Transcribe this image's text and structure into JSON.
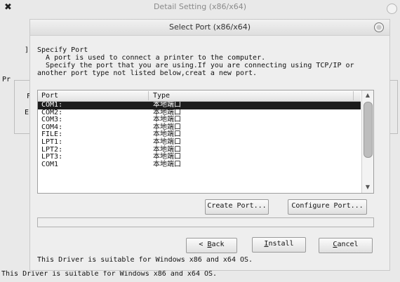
{
  "parent_window": {
    "title": "Detail Setting (x86/x64)",
    "fragments": {
      "bracket": "]",
      "pr": "Pr",
      "f_letter": "F",
      "e_letter": "E"
    },
    "footer_text": "This Driver is suitable for Windows x86 and x64 OS."
  },
  "dialog": {
    "title": "Select Port (x86/x64)",
    "intro": {
      "heading": "Specify Port",
      "line1": "  A port is used to connect a printer to the computer.",
      "line2": "  Specify the port that you are using.If you are connecting using TCP/IP or",
      "line3": "another port type not listed below,creat a new port."
    },
    "table": {
      "columns": [
        "Port",
        "Type"
      ],
      "rows": [
        {
          "port": "COM1:",
          "type": "本地端口",
          "selected": true
        },
        {
          "port": "COM2:",
          "type": "本地端口"
        },
        {
          "port": "COM3:",
          "type": "本地端口"
        },
        {
          "port": "COM4:",
          "type": "本地端口"
        },
        {
          "port": "FILE:",
          "type": "本地端口"
        },
        {
          "port": "LPT1:",
          "type": "本地端口"
        },
        {
          "port": "LPT2:",
          "type": "本地端口"
        },
        {
          "port": "LPT3:",
          "type": "本地端口"
        },
        {
          "port": "COM1",
          "type": "本地端口"
        }
      ]
    },
    "buttons": {
      "create_port": "Create Port...",
      "configure_port": "Configure Port...",
      "back_mnemonic": "B",
      "back_rest": "ack",
      "install_mnemonic": "I",
      "install_rest": "nstall",
      "cancel_mnemonic": "C",
      "cancel_rest": "ancel"
    },
    "driver_note": "This Driver is suitable for Windows x86 and x64 OS."
  },
  "icons": {
    "app": "app-logo-icon",
    "close": "close-icon",
    "scroll_up": "scroll-up-icon",
    "scroll_down": "scroll-down-icon"
  },
  "colors": {
    "selection": "#1c1c1c",
    "background": "#e9e9e9"
  }
}
